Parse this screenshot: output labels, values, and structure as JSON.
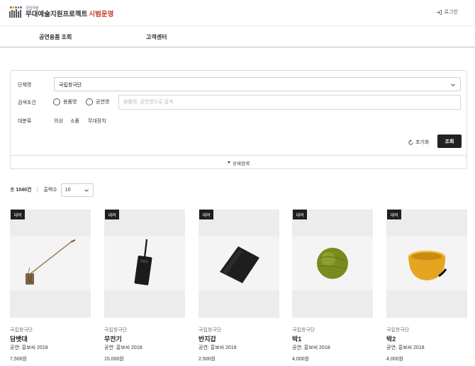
{
  "header": {
    "logo_small": "국립극장",
    "logo_main": "무대예술지원프로젝트",
    "logo_accent": "시범운영",
    "login_label": "로그인"
  },
  "nav": {
    "items": [
      {
        "label": "공연용품 조회"
      },
      {
        "label": "고객센터"
      }
    ]
  },
  "search": {
    "group_label": "단체명",
    "group_value": "국립창극단",
    "condition_label": "검색조건",
    "radio_options": [
      {
        "label": "용품명"
      },
      {
        "label": "공연명"
      }
    ],
    "keyword_placeholder": "용품명, 공연명으로 검색",
    "category_label": "대분류",
    "categories": [
      "의상",
      "소품",
      "무대장치"
    ],
    "reset_label": "초기화",
    "search_label": "조회",
    "detail_label": "상세검색"
  },
  "results": {
    "total_prefix": "총",
    "total_count": "1040건",
    "per_page_label": "출력수",
    "per_page_value": "10"
  },
  "products": [
    {
      "badge": "대여",
      "org": "국립창극단",
      "name": "담뱃대",
      "performance": "공연: 흥보씨 2018",
      "price": "7,500원"
    },
    {
      "badge": "대여",
      "org": "국립창극단",
      "name": "무전기",
      "performance": "공연: 흥보씨 2018",
      "price": "15,000원"
    },
    {
      "badge": "대여",
      "org": "국립창극단",
      "name": "반지갑",
      "performance": "공연: 흥보씨 2018",
      "price": "2,500원"
    },
    {
      "badge": "대여",
      "org": "국립창극단",
      "name": "박1",
      "performance": "공연: 흥보씨 2018",
      "price": "4,000원"
    },
    {
      "badge": "대여",
      "org": "국립창극단",
      "name": "박2",
      "performance": "공연: 흥보씨 2018",
      "price": "4,000원"
    }
  ],
  "colors": {
    "accent": "#c0392b",
    "button_dark": "#222222",
    "badge_bg": "#1f1f1f"
  },
  "icons": {
    "login": "login-arrow-icon",
    "reset": "refresh-icon",
    "dropdown": "chevron-down-icon",
    "detail": "triangle-down-icon"
  }
}
